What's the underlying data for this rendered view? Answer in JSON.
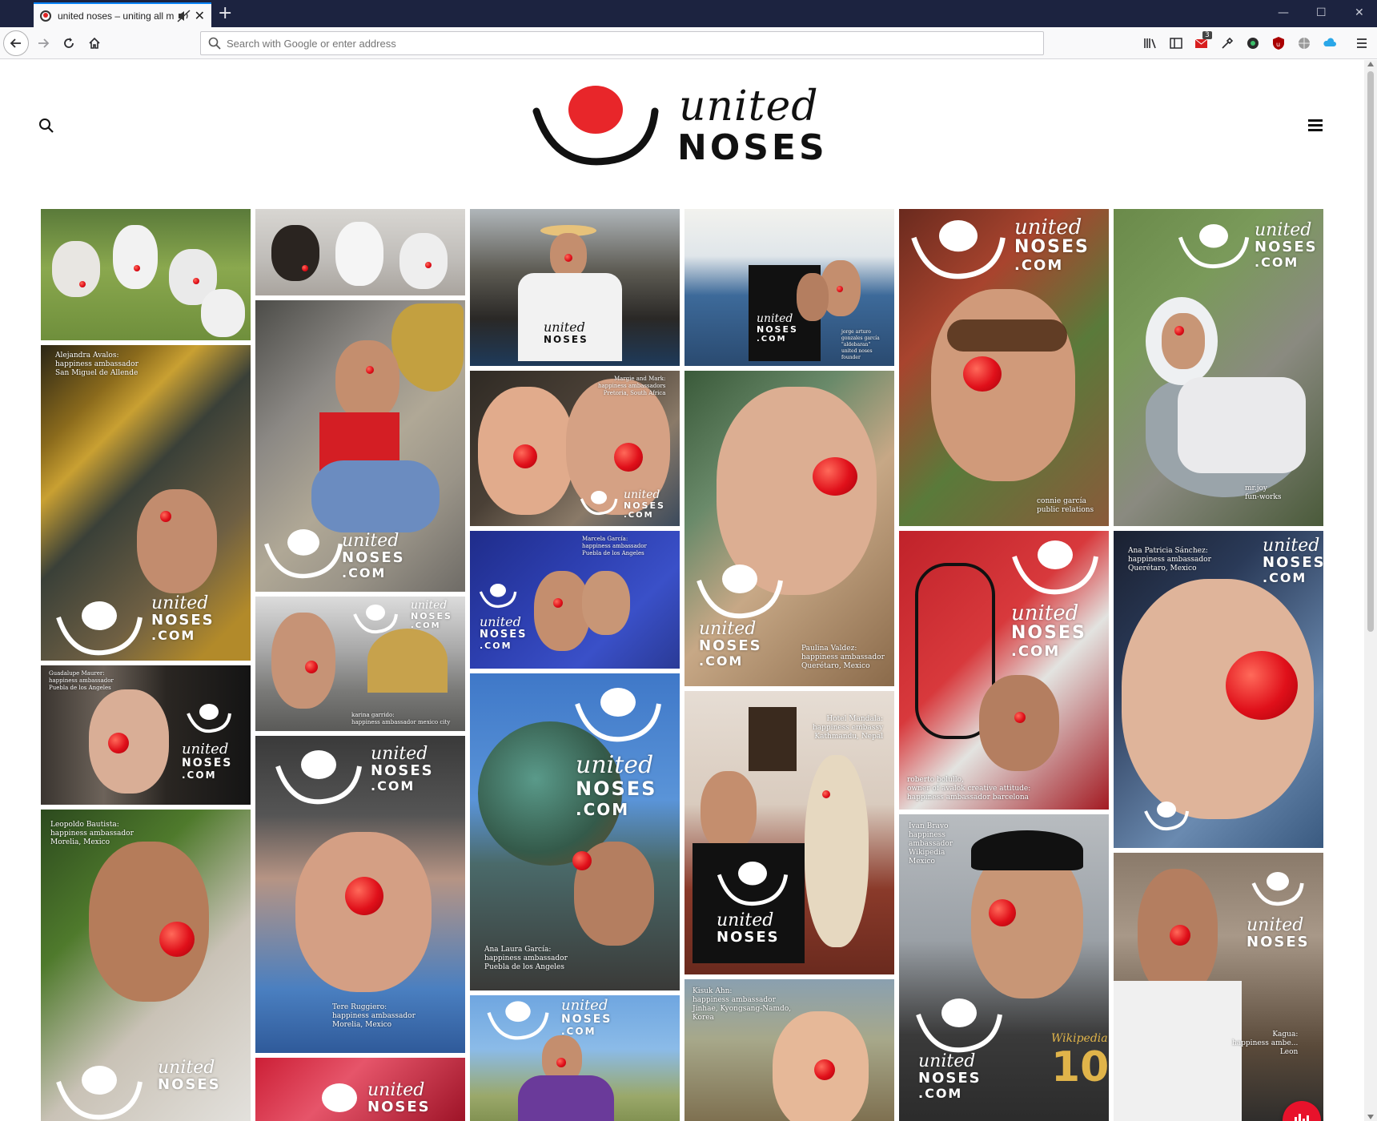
{
  "browser": {
    "tab_title": "united noses – uniting all m",
    "url_placeholder": "Search with Google or enter address",
    "badge_count": "3"
  },
  "site": {
    "logo_word1": "united",
    "logo_word2": "NOSES",
    "watermark_united": "united",
    "watermark_noses": "NOSES",
    "watermark_com": ".COM"
  },
  "captions": {
    "alejandra": "Alejandra Avalos:\nhappiness ambassador\nSan Miguel de Allende",
    "margie": "Margie and Mark:\nhappiness ambassadors\nPretoria, South Africa",
    "marcela": "Marcela García:\nhappiness ambassador\nPuebla de los Angeles",
    "jorge": "jorge arturo\ngonzales garcía\n\"aldebaran\"\nunited noses\nfounder",
    "connie": "connie garcía\npublic relations",
    "mrjoy": "mr.joy\nfun-works",
    "paulina": "Paulina Valdez:\nhappiness ambassador\nQuerétaro, Mexico",
    "anapatricia": "Ana Patricia Sánchez:\nhappiness ambassador\nQuerétaro, Mexico",
    "guadalupe": "Guadalupe Maurer:\nhappiness ambassador\nPuebla de los Angeles",
    "karina": "karina garrido:\nhappiness ambassador mexico city",
    "roberto": "roberto bolullo,\nowner of avalok creative attitude:\nhappiness ambassador barcelona",
    "leopoldo": "Leopoldo Bautista:\nhappiness ambassador\nMorelia, Mexico",
    "hotel": "Hotel Mandala:\nhappiness embassy\nKathmandu, Nepal",
    "ivan": "Ivan Bravo\nhappiness\nambassador\nWikipedia\nMexico",
    "anala": "Ana Laura García:\nhappiness ambassador\nPuebla de los Angeles",
    "tere": "Tere Ruggiero:\nhappiness ambassador\nMorelia, Mexico",
    "kisuk": "Kisuk Ahn:\nhappiness ambassador\nJinhae, Kyongsang-Namdo,\nKorea",
    "kagua": "Kagua:\nhappiness ambe...\nLeon",
    "wikipedia": "Wikipedia",
    "wiki_num": "10"
  }
}
